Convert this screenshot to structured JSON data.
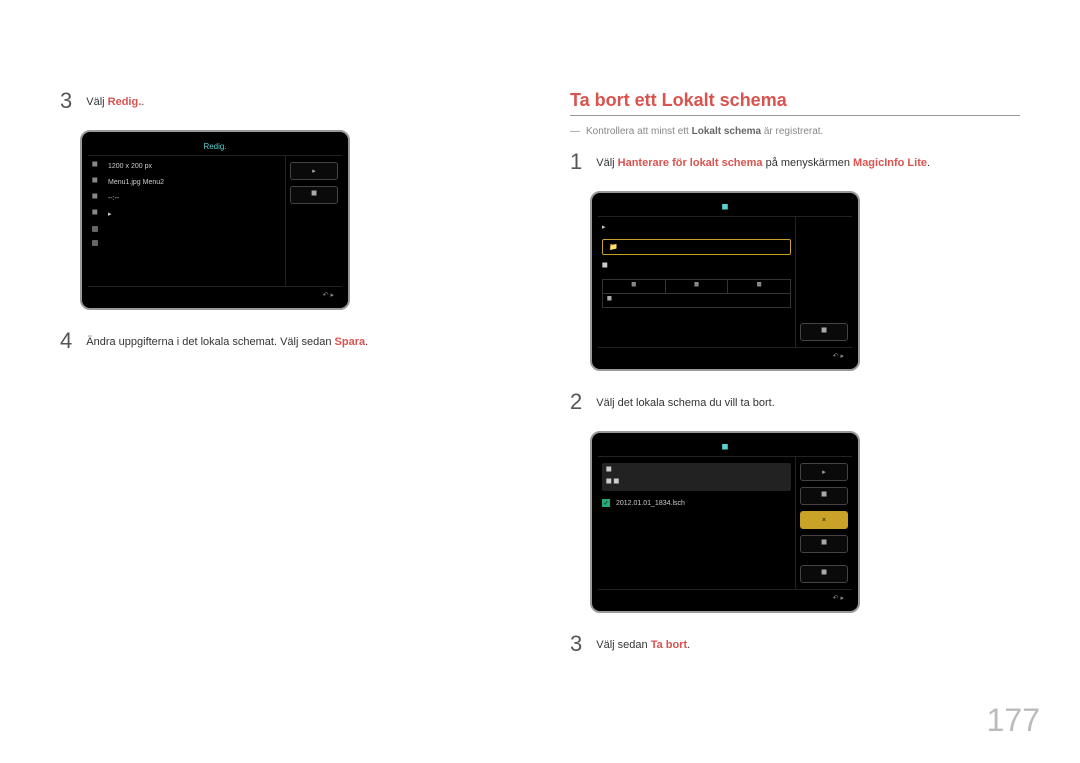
{
  "page_number": "177",
  "left": {
    "step3": {
      "num": "3",
      "pre": "Välj ",
      "accent": "Redig.",
      "post": "."
    },
    "tv1": {
      "title": "Redig.",
      "rows": {
        "r1_label": "⯀",
        "r1_val": "1200 x 200 px",
        "r2_label": "⯀",
        "r2_val": "Menu1.jpg Menu2",
        "r3_label": "⯀",
        "r3_val": "--:--",
        "r4_label": "⯀",
        "r4_val": "▸"
      },
      "side": {
        "a": "▸",
        "b": "⯀"
      },
      "return": "↶ ▸"
    },
    "step4": {
      "num": "4",
      "text_pre": "Ändra uppgifterna i det lokala schemat. Välj sedan ",
      "accent": "Spara",
      "text_post": "."
    }
  },
  "right": {
    "title": "Ta bort ett Lokalt schema",
    "note": {
      "dash": "―",
      "pre": "Kontrollera att minst ett ",
      "bold": "Lokalt schema",
      "post": " är registrerat."
    },
    "step1": {
      "num": "1",
      "pre": "Välj ",
      "a1": "Hanterare för lokalt schema",
      "mid": " på menyskärmen ",
      "a2": "MagicInfo Lite",
      "post": "."
    },
    "tv2": {
      "title": "⯀",
      "rowA": "▸",
      "rowB_icon": "📁",
      "rowB_label": "",
      "rowC": "⯀",
      "side": "⯀",
      "head1": "⯀",
      "head2": "⯀",
      "head3": "⯀",
      "frow": "⯀",
      "return": "↶ ▸"
    },
    "step2": {
      "num": "2",
      "text": "Välj det lokala schema du vill ta bort."
    },
    "tv3": {
      "title": "⯀",
      "left_icon_a": "⯀",
      "left_icon_b": "⯀ ⯀",
      "file": "2012.01.01_1834.lsch",
      "side": {
        "a": "▸",
        "b": "⯀",
        "c": "×",
        "d": "⯀",
        "e": "⯀"
      },
      "return": "↶ ▸"
    },
    "step3": {
      "num": "3",
      "pre": "Välj sedan ",
      "accent": "Ta bort",
      "post": "."
    }
  }
}
